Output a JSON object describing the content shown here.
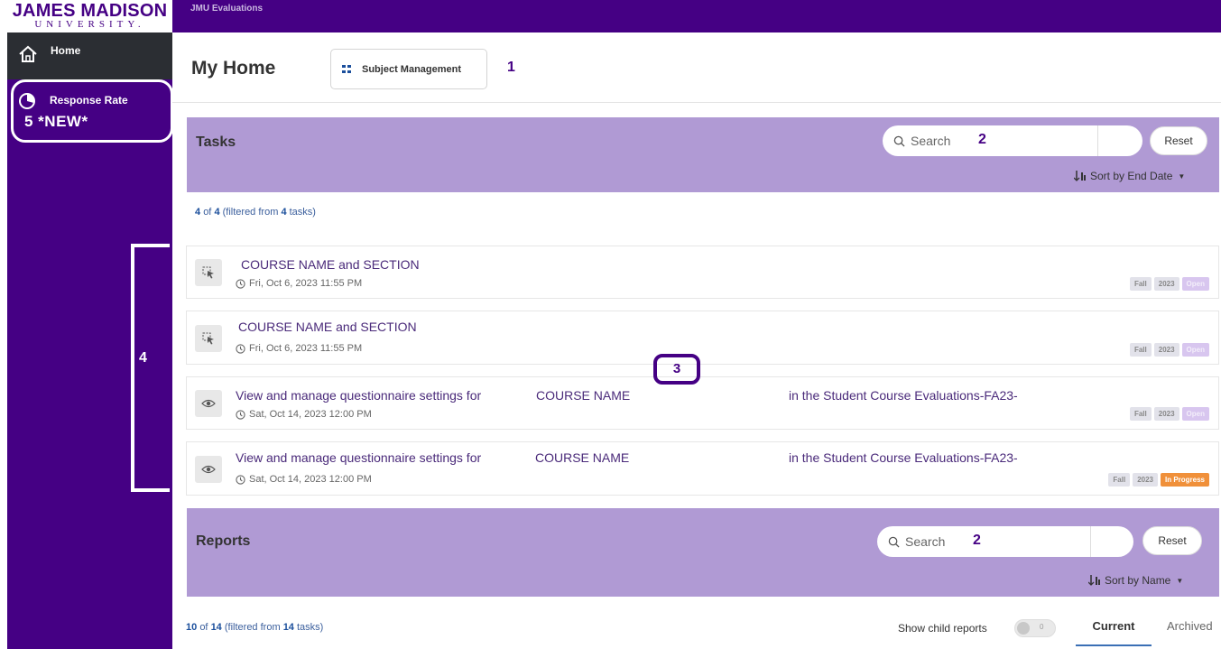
{
  "app": {
    "logo_main": "JAMES MADISON",
    "logo_sub": "UNIVERSITY.",
    "topbar_title": "JMU Evaluations"
  },
  "sidebar": {
    "home_label": "Home",
    "response_rate_label": "Response Rate",
    "response_rate_annotation": "5  *NEW*"
  },
  "header": {
    "title": "My Home",
    "subject_management_label": "Subject Management",
    "annotation_1": "1"
  },
  "tasks": {
    "title": "Tasks",
    "search_placeholder": "Search",
    "search_annotation": "2",
    "reset_label": "Reset",
    "sort_label": "Sort by End Date",
    "count_shown": "4",
    "count_total": "4",
    "count_filtered": "4",
    "count_word_of": "of",
    "count_prefix": "(filtered from",
    "count_suffix": "tasks)",
    "items": [
      {
        "icon": "cursor-select-icon",
        "title": "COURSE NAME and SECTION",
        "date": "Fri, Oct 6, 2023 11:55 PM",
        "badges": [
          "Fall",
          "2023",
          "Open"
        ],
        "status": "open"
      },
      {
        "icon": "cursor-select-icon",
        "title": "COURSE NAME and SECTION",
        "date": "Fri, Oct 6, 2023 11:55 PM",
        "badges": [
          "Fall",
          "2023",
          "Open"
        ],
        "status": "open"
      },
      {
        "icon": "eye-icon",
        "title_part1": "View and manage questionnaire settings for",
        "title_part2": "COURSE NAME",
        "title_part3": "in the Student Course Evaluations-FA23-",
        "date": "Sat, Oct 14, 2023 12:00 PM",
        "badges": [
          "Fall",
          "2023",
          "Open"
        ],
        "status": "open"
      },
      {
        "icon": "eye-icon",
        "title_part1": "View and manage questionnaire settings for",
        "title_part2": "COURSE NAME",
        "title_part3": "in the Student Course Evaluations-FA23-",
        "date": "Sat, Oct 14, 2023 12:00 PM",
        "badges": [
          "Fall",
          "2023",
          "In Progress"
        ],
        "status": "in-progress"
      }
    ],
    "annotation_3": "3",
    "annotation_4": "4"
  },
  "reports": {
    "title": "Reports",
    "search_placeholder": "Search",
    "search_annotation": "2",
    "reset_label": "Reset",
    "sort_label": "Sort by Name",
    "count_shown": "10",
    "count_total": "14",
    "count_filtered": "14",
    "count_word_of": "of",
    "count_prefix": "(filtered from",
    "count_suffix": "tasks)",
    "child_reports_label": "Show child reports",
    "child_reports_value": "0",
    "tab_current": "Current",
    "tab_archived": "Archived"
  },
  "colors": {
    "brand_purple": "#450084",
    "panel_lavender": "#b09ad4",
    "in_progress": "#f0903a"
  }
}
